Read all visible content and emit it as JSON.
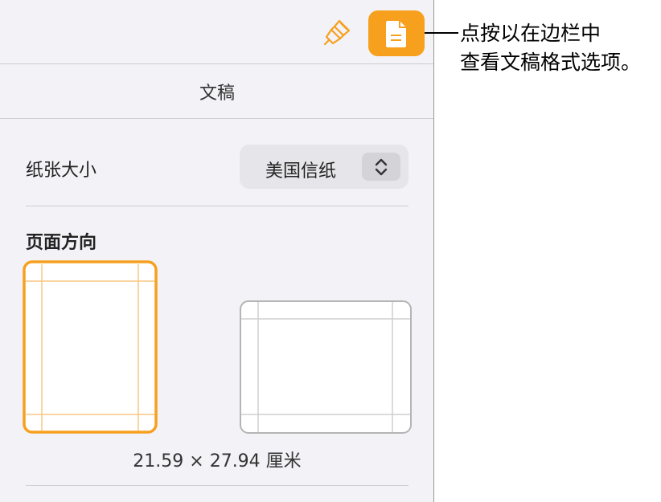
{
  "toolbar": {
    "format_icon": "paintbrush-icon",
    "document_icon": "document-icon",
    "accent_color": "#f7a01e"
  },
  "header": {
    "title": "文稿"
  },
  "paper_size": {
    "label": "纸张大小",
    "value": "美国信纸"
  },
  "orientation": {
    "label": "页面方向",
    "options": [
      "portrait",
      "landscape"
    ],
    "selected": "portrait"
  },
  "dimensions": "21.59 × 27.94 厘米",
  "callout": {
    "line1": "点按以在边栏中",
    "line2": "查看文稿格式选项。"
  }
}
